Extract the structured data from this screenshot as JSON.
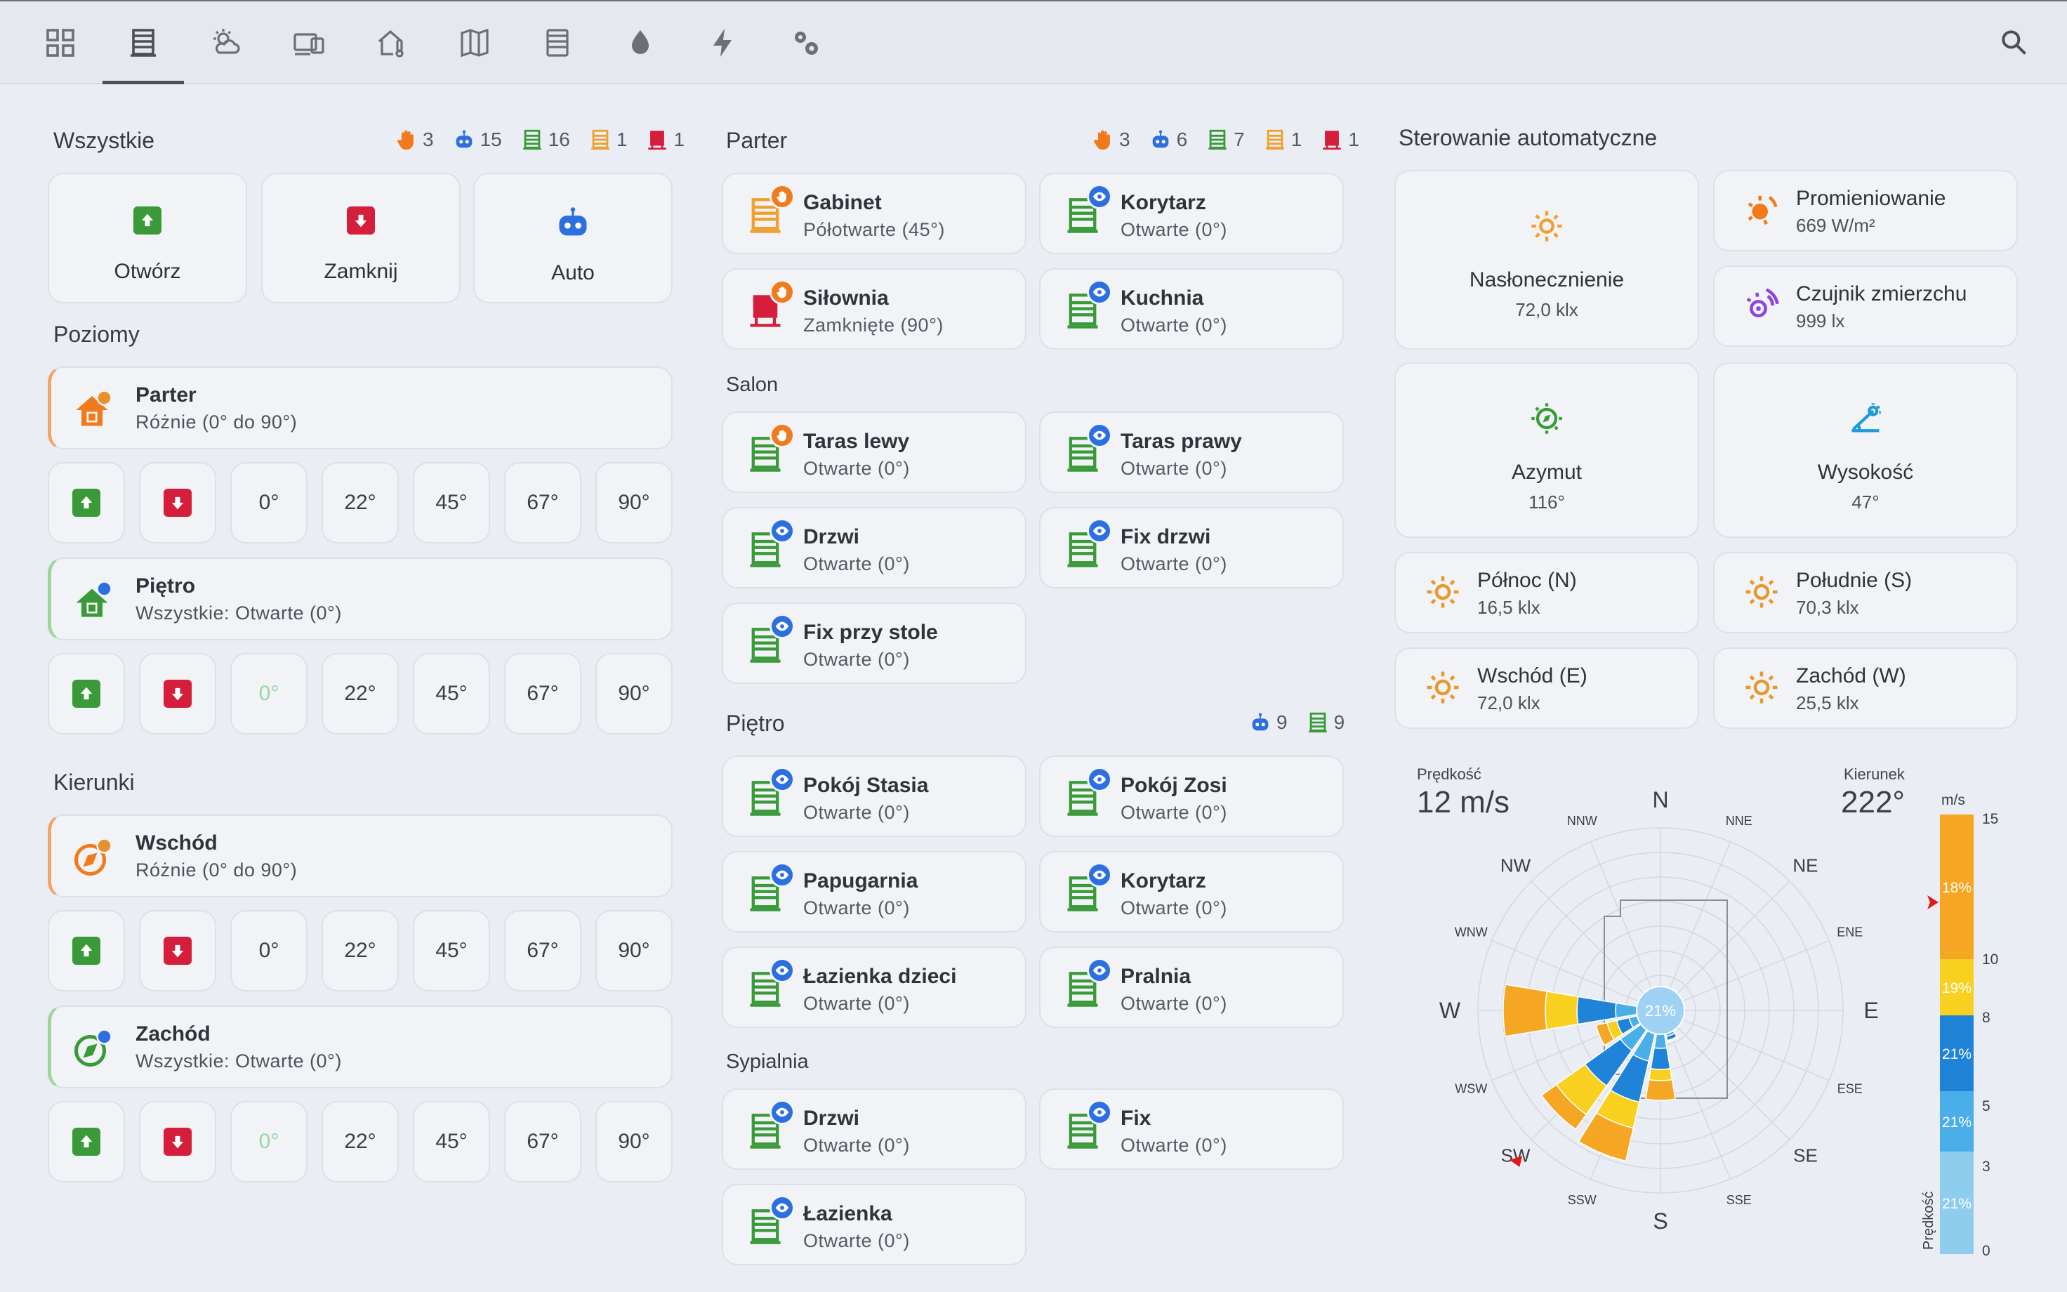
{
  "colors": {
    "manual": "#f07a1c",
    "auto": "#2c6fe0",
    "open": "#3a9a3a",
    "partial": "#f0a02c",
    "closed": "#d41e3c"
  },
  "tabs": [
    {
      "icon": "grid-icon"
    },
    {
      "icon": "blinds-icon"
    },
    {
      "icon": "weather-icon"
    },
    {
      "icon": "devices-icon"
    },
    {
      "icon": "home-thermometer-icon"
    },
    {
      "icon": "map-icon"
    },
    {
      "icon": "radiator-icon"
    },
    {
      "icon": "water-drop-icon"
    },
    {
      "icon": "lightning-icon"
    },
    {
      "icon": "settings-icon"
    }
  ],
  "all": {
    "title": "Wszystkie",
    "stats": {
      "manual": "3",
      "auto": "15",
      "open": "16",
      "partial": "1",
      "closed": "1"
    },
    "open_label": "Otwórz",
    "close_label": "Zamknij",
    "auto_label": "Auto"
  },
  "horizontal": {
    "title": "Poziomy",
    "ground": {
      "name": "Parter",
      "state": "Różnie (0° do 90°)"
    },
    "floor": {
      "name": "Piętro",
      "state": "Wszystkie: Otwarte (0°)"
    }
  },
  "directions": {
    "title": "Kierunki",
    "east": {
      "name": "Wschód",
      "state": "Różnie (0° do 90°)"
    },
    "west": {
      "name": "Zachód",
      "state": "Wszystkie: Otwarte (0°)"
    }
  },
  "angles": [
    "0°",
    "22°",
    "45°",
    "67°",
    "90°"
  ],
  "parter": {
    "title": "Parter",
    "stats": {
      "manual": "3",
      "auto": "6",
      "open": "7",
      "partial": "1",
      "closed": "1"
    },
    "devices": [
      {
        "name": "Gabinet",
        "state": "Półotwarte (45°)"
      },
      {
        "name": "Korytarz",
        "state": "Otwarte (0°)"
      },
      {
        "name": "Siłownia",
        "state": "Zamknięte (90°)"
      },
      {
        "name": "Kuchnia",
        "state": "Otwarte (0°)"
      }
    ]
  },
  "salon": {
    "title": "Salon",
    "devices": [
      {
        "name": "Taras lewy",
        "state": "Otwarte (0°)"
      },
      {
        "name": "Taras prawy",
        "state": "Otwarte (0°)"
      },
      {
        "name": "Drzwi",
        "state": "Otwarte (0°)"
      },
      {
        "name": "Fix drzwi",
        "state": "Otwarte (0°)"
      },
      {
        "name": "Fix przy stole",
        "state": "Otwarte (0°)"
      }
    ]
  },
  "pietro": {
    "title": "Piętro",
    "stats": {
      "auto": "9",
      "open": "9"
    },
    "devices": [
      {
        "name": "Pokój Stasia",
        "state": "Otwarte (0°)"
      },
      {
        "name": "Pokój Zosi",
        "state": "Otwarte (0°)"
      },
      {
        "name": "Papugarnia",
        "state": "Otwarte (0°)"
      },
      {
        "name": "Korytarz",
        "state": "Otwarte (0°)"
      },
      {
        "name": "Łazienka dzieci",
        "state": "Otwarte (0°)"
      },
      {
        "name": "Pralnia",
        "state": "Otwarte (0°)"
      }
    ]
  },
  "sypialnia": {
    "title": "Sypialnia",
    "devices": [
      {
        "name": "Drzwi",
        "state": "Otwarte (0°)"
      },
      {
        "name": "Fix",
        "state": "Otwarte (0°)"
      },
      {
        "name": "Łazienka",
        "state": "Otwarte (0°)"
      }
    ]
  },
  "automation": {
    "title": "Sterowanie automatyczne",
    "sensors": [
      {
        "name": "Nasłonecznienie",
        "value": "72,0 klx",
        "icon": "sun-icon"
      },
      {
        "name": "Promieniowanie",
        "value": "669 W/m²",
        "icon": "radiation-icon"
      },
      {
        "name": "Czujnik zmierzchu",
        "value": "999 lx",
        "icon": "dusk-sensor-icon"
      },
      {
        "name": "Azymut",
        "value": "116°",
        "icon": "azimuth-icon"
      },
      {
        "name": "Wysokość",
        "value": "47°",
        "icon": "elevation-icon"
      },
      {
        "name": "Północ (N)",
        "value": "16,5 klx",
        "icon": "sun-icon"
      },
      {
        "name": "Południe (S)",
        "value": "70,3 klx",
        "icon": "sun-icon"
      },
      {
        "name": "Wschód (E)",
        "value": "72,0 klx",
        "icon": "sun-icon"
      },
      {
        "name": "Zachód (W)",
        "value": "25,5 klx",
        "icon": "sun-icon"
      }
    ]
  },
  "wind": {
    "speed_label": "Prędkość",
    "speed_value": "12 m/s",
    "direction_label": "Kierunek",
    "direction_value": "222°",
    "center_label": "21%",
    "compass": [
      "N",
      "NNE",
      "NE",
      "ENE",
      "E",
      "ESE",
      "SE",
      "SSE",
      "S",
      "SSW",
      "SW",
      "WSW",
      "W",
      "WNW",
      "NW",
      "NNW"
    ],
    "scale_unit": "m/s",
    "scale_axis_label": "Prędkość",
    "scale_ticks": [
      "15",
      "10",
      "8",
      "5",
      "3",
      "0"
    ],
    "scale_bands": [
      {
        "label": "18%",
        "color": "#f5a623"
      },
      {
        "label": "19%",
        "color": "#f8d020"
      },
      {
        "label": "21%",
        "color": "#1f84d8"
      },
      {
        "label": "21%",
        "color": "#4aaee8"
      },
      {
        "label": "21%",
        "color": "#8fcdef"
      }
    ]
  }
}
